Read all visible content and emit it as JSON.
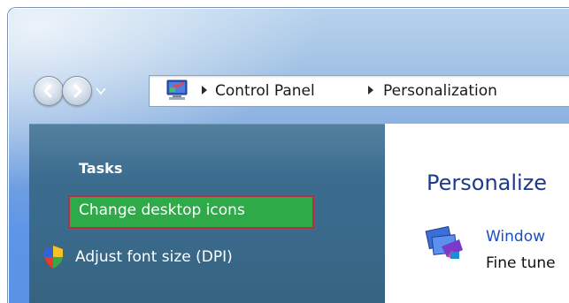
{
  "address_bar": {
    "crumbs": [
      "Control Panel",
      "Personalization"
    ]
  },
  "task_pane": {
    "heading": "Tasks",
    "links": [
      "Change desktop icons",
      "Adjust font size (DPI)"
    ]
  },
  "content": {
    "title": "Personalize",
    "item_link": "Window",
    "item_desc": "Fine tune"
  },
  "icons": {
    "back": "back-arrow-icon",
    "forward": "forward-arrow-icon",
    "history": "chevron-down-icon",
    "location": "control-panel-icon",
    "separator": "breadcrumb-arrow-icon",
    "dpi": "uac-shield-icon",
    "window_color": "window-color-icon"
  },
  "colors": {
    "task_pane_bg": "#3a6a8c",
    "highlight_fill": "#2eaa48",
    "highlight_border": "#b6313d",
    "title_blue": "#1e3b8a",
    "link_blue": "#1a4fb8"
  }
}
